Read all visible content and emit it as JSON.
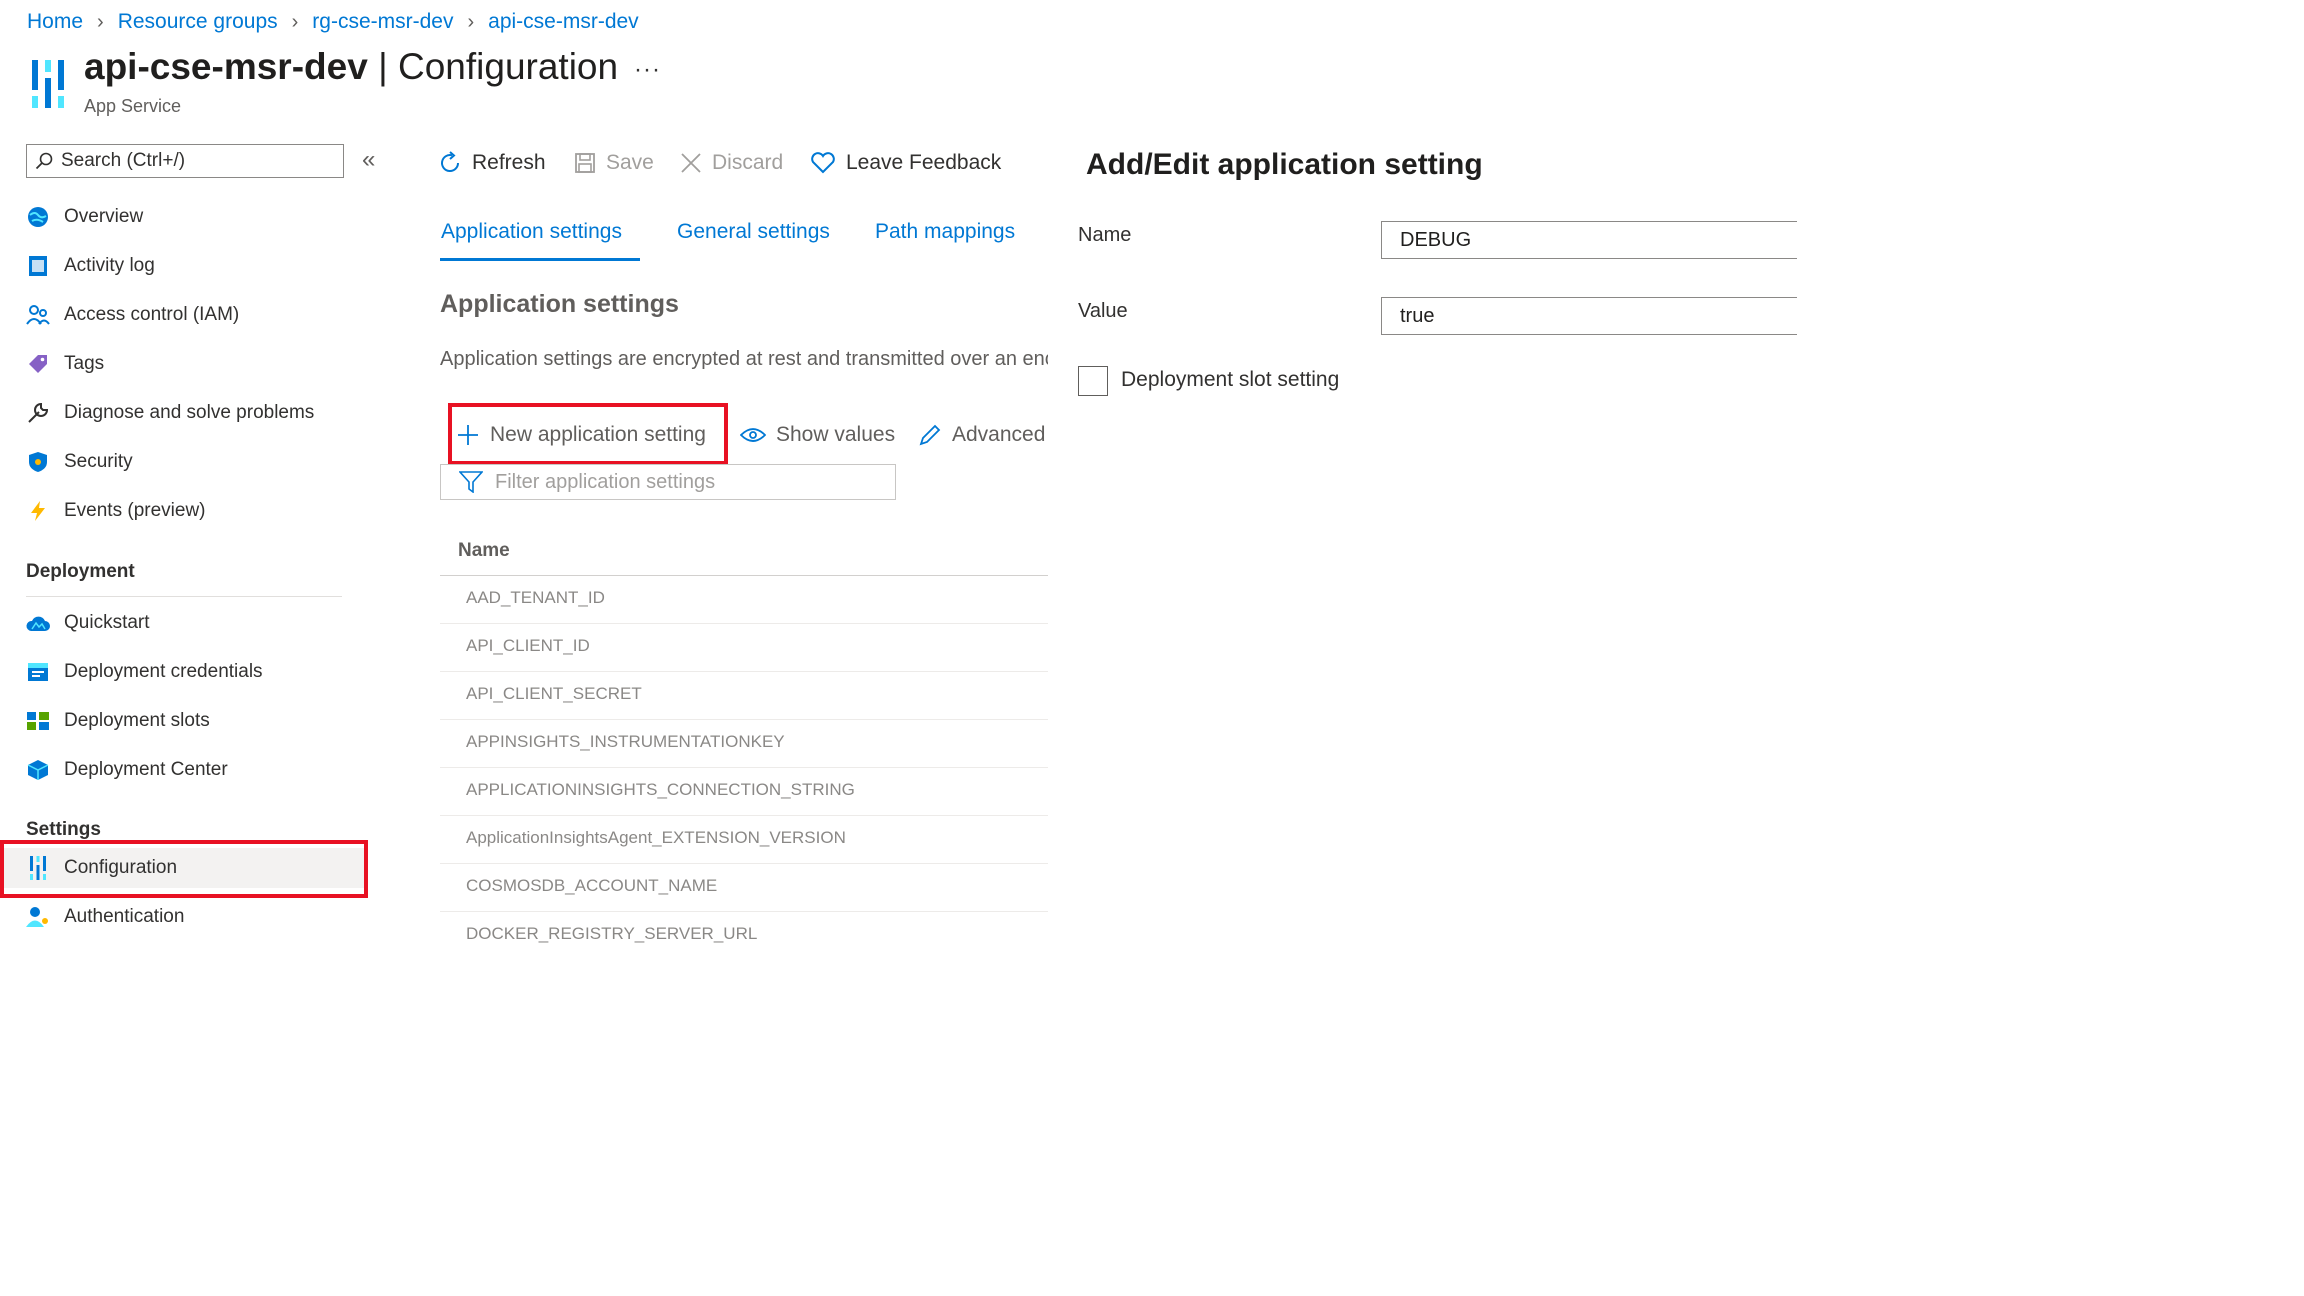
{
  "breadcrumb": [
    "Home",
    "Resource groups",
    "rg-cse-msr-dev",
    "api-cse-msr-dev"
  ],
  "header": {
    "resource_name": "api-cse-msr-dev",
    "separator": "|",
    "page": "Configuration",
    "subtitle": "App Service",
    "more": "···"
  },
  "search": {
    "placeholder": "Search (Ctrl+/)"
  },
  "collapse": "«",
  "nav": {
    "top_items": [
      "Overview",
      "Activity log",
      "Access control (IAM)",
      "Tags",
      "Diagnose and solve problems",
      "Security",
      "Events (preview)"
    ],
    "deployment_title": "Deployment",
    "deployment_items": [
      "Quickstart",
      "Deployment credentials",
      "Deployment slots",
      "Deployment Center"
    ],
    "settings_title": "Settings",
    "settings_items": [
      "Configuration",
      "Authentication"
    ],
    "selected": "Configuration"
  },
  "toolbar": {
    "refresh": "Refresh",
    "save": "Save",
    "discard": "Discard",
    "feedback": "Leave Feedback"
  },
  "tabs": [
    "Application settings",
    "General settings",
    "Path mappings"
  ],
  "active_tab": "Application settings",
  "main": {
    "heading": "Application settings",
    "description": "Application settings are encrypted at rest and transmitted over an encrypted channel.",
    "new_setting": "New application setting",
    "show_values": "Show values",
    "advanced_edit": "Advanced edit",
    "filter_placeholder": "Filter application settings",
    "column_name": "Name",
    "rows": [
      "AAD_TENANT_ID",
      "API_CLIENT_ID",
      "API_CLIENT_SECRET",
      "APPINSIGHTS_INSTRUMENTATIONKEY",
      "APPLICATIONINSIGHTS_CONNECTION_STRING",
      "ApplicationInsightsAgent_EXTENSION_VERSION",
      "COSMOSDB_ACCOUNT_NAME",
      "DOCKER_REGISTRY_SERVER_URL"
    ]
  },
  "panel": {
    "title": "Add/Edit application setting",
    "name_label": "Name",
    "name_value": "DEBUG",
    "value_label": "Value",
    "value_value": "true",
    "slot_setting_label": "Deployment slot setting",
    "slot_setting_checked": false
  },
  "colors": {
    "accent": "#0078d4",
    "highlight": "#e81123"
  }
}
